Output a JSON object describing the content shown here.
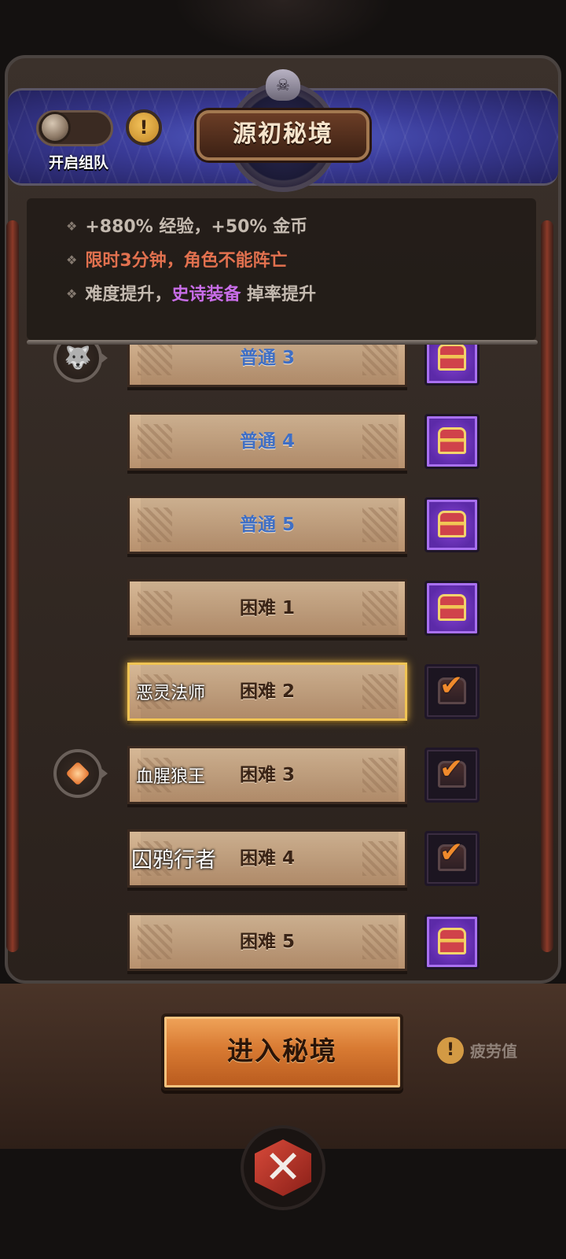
{
  "header": {
    "title": "源初秘境",
    "team_toggle_label": "开启组队",
    "info_icon": "exclamation-icon"
  },
  "bonuses": [
    {
      "text": "+880% 经验，+50% 金币",
      "color": "#c4bab0"
    },
    {
      "text": "限时3分钟，角色不能阵亡",
      "color": "#e2714f"
    },
    {
      "parts": [
        {
          "text": "难度提升，",
          "color": "#c4bab0"
        },
        {
          "text": "史诗装备",
          "color": "#c86de8"
        },
        {
          "text": " 掉率提升",
          "color": "#c4bab0"
        }
      ]
    }
  ],
  "levels": [
    {
      "label": "普通 3",
      "difficulty": "normal",
      "boss": "",
      "chest": "available",
      "marker": "dog-icon"
    },
    {
      "label": "普通 4",
      "difficulty": "normal",
      "boss": "",
      "chest": "available",
      "marker": ""
    },
    {
      "label": "普通 5",
      "difficulty": "normal",
      "boss": "",
      "chest": "available",
      "marker": ""
    },
    {
      "label": "困难 1",
      "difficulty": "hard",
      "boss": "",
      "chest": "available",
      "marker": ""
    },
    {
      "label": "困难 2",
      "difficulty": "hard",
      "boss": "恶灵法师",
      "chest": "claimed",
      "selected": true,
      "marker": ""
    },
    {
      "label": "困难 3",
      "difficulty": "hard",
      "boss": "血腥狼王",
      "chest": "claimed",
      "marker": "gem-icon"
    },
    {
      "label": "困难 4",
      "difficulty": "hard",
      "boss": "囚鸦行者",
      "chest": "claimed",
      "marker": ""
    },
    {
      "label": "困难 5",
      "difficulty": "hard",
      "boss": "",
      "chest": "available",
      "marker": ""
    }
  ],
  "footer": {
    "enter_button": "进入秘境",
    "fatigue_label": "疲劳值",
    "close_icon": "crossed-swords-close-icon"
  },
  "colors": {
    "normal_label": "#3f6fc5",
    "hard_label": "#3a2416",
    "accent_orange": "#d87a32",
    "selected_border": "#f0c454",
    "chest_purple": "#5c2aa8"
  }
}
